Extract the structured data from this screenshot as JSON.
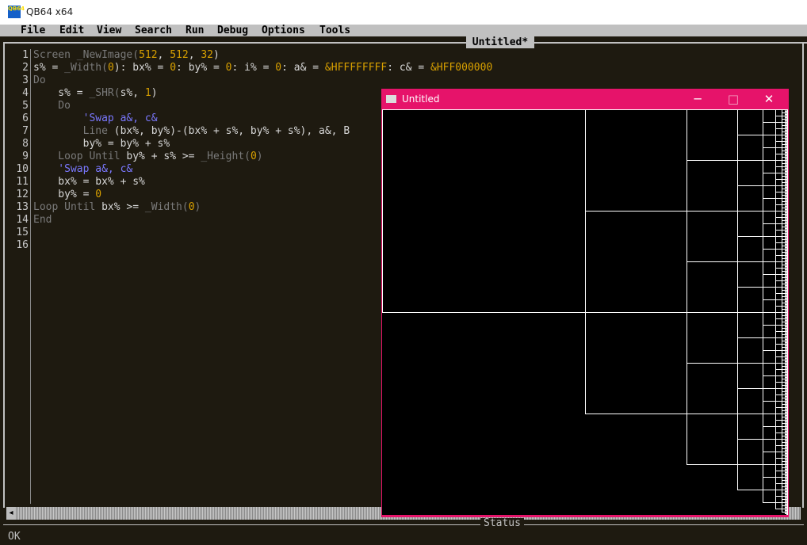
{
  "app": {
    "title": "QB64 x64",
    "icon_text": "QB64"
  },
  "menu": [
    "File",
    "Edit",
    "View",
    "Search",
    "Run",
    "Debug",
    "Options",
    "Tools"
  ],
  "editor": {
    "tab_title": "Untitled*",
    "lines": [
      {
        "n": "1",
        "tokens": [
          [
            "kw",
            "Screen _NewImage("
          ],
          [
            "nm",
            "512"
          ],
          [
            "id",
            ", "
          ],
          [
            "nm",
            "512"
          ],
          [
            "id",
            ", "
          ],
          [
            "nm",
            "32"
          ],
          [
            "id",
            ")"
          ]
        ]
      },
      {
        "n": "2",
        "tokens": [
          [
            "id",
            "s% = "
          ],
          [
            "kw",
            "_Width("
          ],
          [
            "nm",
            "0"
          ],
          [
            "id",
            "): bx% = "
          ],
          [
            "nm",
            "0"
          ],
          [
            "id",
            ": by% = "
          ],
          [
            "nm",
            "0"
          ],
          [
            "id",
            ": i% = "
          ],
          [
            "nm",
            "0"
          ],
          [
            "id",
            ": a& = "
          ],
          [
            "nm",
            "&HFFFFFFFF"
          ],
          [
            "id",
            ": c& = "
          ],
          [
            "nm",
            "&HFF000000"
          ]
        ]
      },
      {
        "n": "3",
        "tokens": [
          [
            "kw",
            "Do"
          ]
        ]
      },
      {
        "n": "4",
        "tokens": [
          [
            "id",
            "    s% = "
          ],
          [
            "kw",
            "_SHR("
          ],
          [
            "id",
            "s%, "
          ],
          [
            "nm",
            "1"
          ],
          [
            "id",
            ")"
          ]
        ]
      },
      {
        "n": "5",
        "tokens": [
          [
            "kw",
            "    Do"
          ]
        ]
      },
      {
        "n": "6",
        "tokens": [
          [
            "cm",
            "        'Swap a&, c&"
          ]
        ]
      },
      {
        "n": "7",
        "tokens": [
          [
            "kw",
            "        Line "
          ],
          [
            "id",
            "(bx%, by%)-(bx% + s%, by% + s%), a&, B"
          ]
        ]
      },
      {
        "n": "8",
        "tokens": [
          [
            "id",
            "        by% = by% + s%"
          ]
        ]
      },
      {
        "n": "9",
        "tokens": [
          [
            "kw",
            "    Loop Until "
          ],
          [
            "id",
            "by% + s% >= "
          ],
          [
            "kw",
            "_Height("
          ],
          [
            "nm",
            "0"
          ],
          [
            "kw",
            ")"
          ]
        ]
      },
      {
        "n": "10",
        "tokens": [
          [
            "cm",
            "    'Swap a&, c&"
          ]
        ]
      },
      {
        "n": "11",
        "tokens": [
          [
            "id",
            "    bx% = bx% + s%"
          ]
        ]
      },
      {
        "n": "12",
        "tokens": [
          [
            "id",
            "    by% = "
          ],
          [
            "nm",
            "0"
          ]
        ]
      },
      {
        "n": "13",
        "tokens": [
          [
            "kw",
            "Loop Until "
          ],
          [
            "id",
            "bx% >= "
          ],
          [
            "kw",
            "_Width("
          ],
          [
            "nm",
            "0"
          ],
          [
            "kw",
            ")"
          ]
        ]
      },
      {
        "n": "14",
        "tokens": [
          [
            "kw",
            "End"
          ]
        ]
      },
      {
        "n": "15",
        "tokens": []
      },
      {
        "n": "16",
        "tokens": []
      }
    ]
  },
  "status": {
    "label": "Status",
    "text": "OK"
  },
  "output_window": {
    "title": "Untitled",
    "minimize": "─",
    "maximize": "□",
    "close": "✕",
    "accent": "#e6136a"
  },
  "colors": {
    "keyword": "#7a7a7a",
    "number": "#d8a000",
    "ident": "#d6d6d6",
    "comment": "#7a78ff",
    "background": "#1e1a10"
  }
}
